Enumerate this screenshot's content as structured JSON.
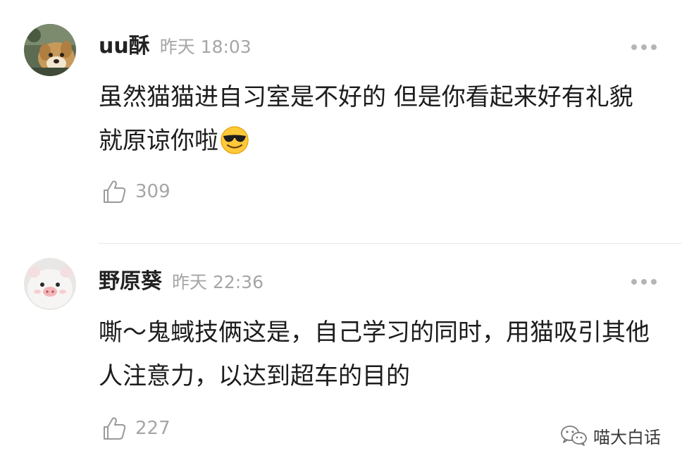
{
  "comments": [
    {
      "username": "uu酥",
      "time": "昨天 18:03",
      "text": "虽然猫猫进自习室是不好的 但是你看起来好有礼貌 就原谅你啦",
      "emoji": "smiling-face-with-sunglasses",
      "likes": "309",
      "avatar": "dog-avatar"
    },
    {
      "username": "野原葵",
      "time": "昨天 22:36",
      "text": "嘶～鬼蜮技俩这是，自己学习的同时，用猫吸引其他人注意力，以达到超车的目的",
      "likes": "227",
      "avatar": "pig-plush-avatar"
    }
  ],
  "watermark": {
    "text": "喵大白话",
    "icon": "wechat-icon"
  },
  "colors": {
    "background": "#ffffff",
    "username": "#222222",
    "meta": "#a6a6a6",
    "divider": "#e8e8e8",
    "body": "#1c1c1c"
  }
}
